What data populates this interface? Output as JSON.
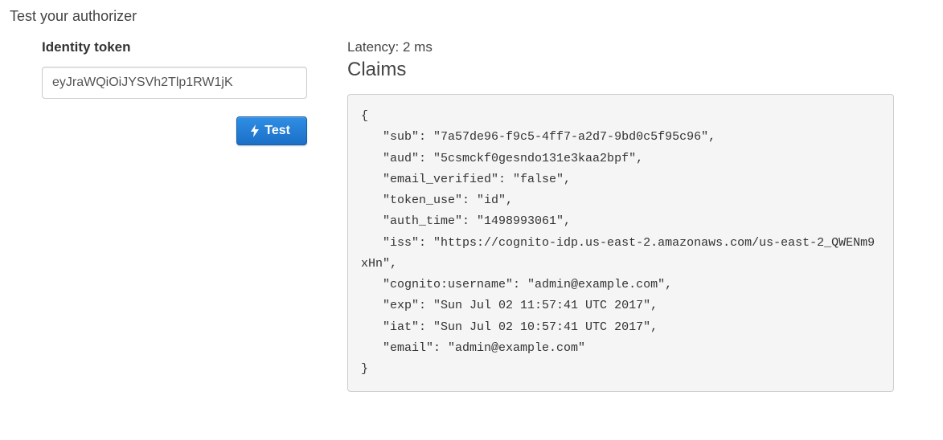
{
  "page_title": "Test your authorizer",
  "identity": {
    "label": "Identity token",
    "value": "eyJraWQiOiJYSVh2Tlp1RW1jK"
  },
  "test_button_label": "Test",
  "latency_label": "Latency: 2 ms",
  "claims_title": "Claims",
  "claims": {
    "sub": "7a57de96-f9c5-4ff7-a2d7-9bd0c5f95c96",
    "aud": "5csmckf0gesndo131e3kaa2bpf",
    "email_verified": "false",
    "token_use": "id",
    "auth_time": "1498993061",
    "iss": "https://cognito-idp.us-east-2.amazonaws.com/us-east-2_QWENm9xHn",
    "cognito:username": "admin@example.com",
    "exp": "Sun Jul 02 11:57:41 UTC 2017",
    "iat": "Sun Jul 02 10:57:41 UTC 2017",
    "email": "admin@example.com"
  }
}
